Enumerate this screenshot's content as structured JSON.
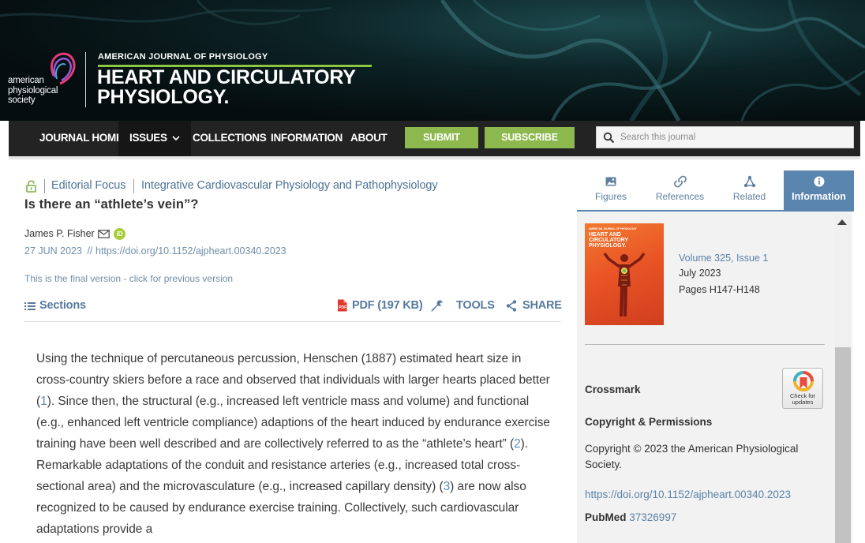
{
  "journal": {
    "society_line1": "american",
    "society_line2": "physiological",
    "society_line3": "society",
    "small_title": "AMERICAN JOURNAL OF PHYSIOLOGY",
    "big_title_line1": "HEART AND CIRCULATORY",
    "big_title_line2": "PHYSIOLOGY.",
    "accent_color": "#8dc63f"
  },
  "nav": {
    "items": [
      "JOURNAL HOME",
      "ISSUES",
      "COLLECTIONS",
      "INFORMATION",
      "ABOUT"
    ],
    "submit_label": "SUBMIT",
    "subscribe_label": "SUBSCRIBE",
    "search_placeholder": "Search this journal",
    "button_color": "#8cb84e"
  },
  "article": {
    "type": "Editorial Focus",
    "category": "Integrative Cardiovascular Physiology and Pathophysiology",
    "title": "Is there an “athlete’s vein”?",
    "author": "James P. Fisher",
    "orcid_label": "iD",
    "date": "27 JUN 2023",
    "date_sep": "//",
    "doi": "https://doi.org/10.1152/ajpheart.00340.2023",
    "version_note": "This is the final version - click for previous version"
  },
  "toolbar": {
    "sections_label": "Sections",
    "pdf_label": "PDF (197 KB)",
    "tools_label": "TOOLS",
    "share_label": "SHARE"
  },
  "body": {
    "p1_a": "Using the technique of percutaneous percussion, Henschen (1887) estimated heart size in cross-country skiers before a race and observed that individuals with larger hearts placed better (",
    "ref1": "1",
    "p1_b": "). Since then, the structural (e.g., increased left ventricle mass and volume) and functional (e.g., enhanced left ventricle compliance) adaptions of the heart induced by endurance exercise training have been well described and are collectively referred to as the “athlete’s heart” (",
    "ref2": "2",
    "p1_c": "). Remarkable adaptations of the conduit and resistance arteries (e.g., increased total cross-sectional area) and the microvasculature (e.g., increased capillary density) (",
    "ref3": "3",
    "p1_d": ") are now also recognized to be caused by endurance exercise training. Collectively, such cardiovascular adaptations provide a"
  },
  "sidebar": {
    "tabs": [
      {
        "label": "Figures",
        "icon": "image-icon"
      },
      {
        "label": "References",
        "icon": "link-icon"
      },
      {
        "label": "Related",
        "icon": "network-icon"
      },
      {
        "label": "Information",
        "icon": "info-icon"
      }
    ],
    "active_tab": "Information",
    "cover_small": "AMERICAN JOURNAL OF PHYSIOLOGY",
    "cover_title_line1": "HEART AND",
    "cover_title_line2": "CIRCULATORY",
    "cover_title_line3": "PHYSIOLOGY.",
    "volume": "Volume 325, Issue 1",
    "issue_date": "July 2023",
    "pages": "Pages H147-H148",
    "crossmark": "Crossmark",
    "check_line1": "Check for",
    "check_line2": "updates",
    "copyright_heading": "Copyright & Permissions",
    "copyright_text": "Copyright © 2023 the American Physiological Society.",
    "doi": "https://doi.org/10.1152/ajpheart.00340.2023",
    "pubmed_label": "PubMed",
    "pubmed_id": "37326997",
    "active_color": "#5a85af"
  }
}
